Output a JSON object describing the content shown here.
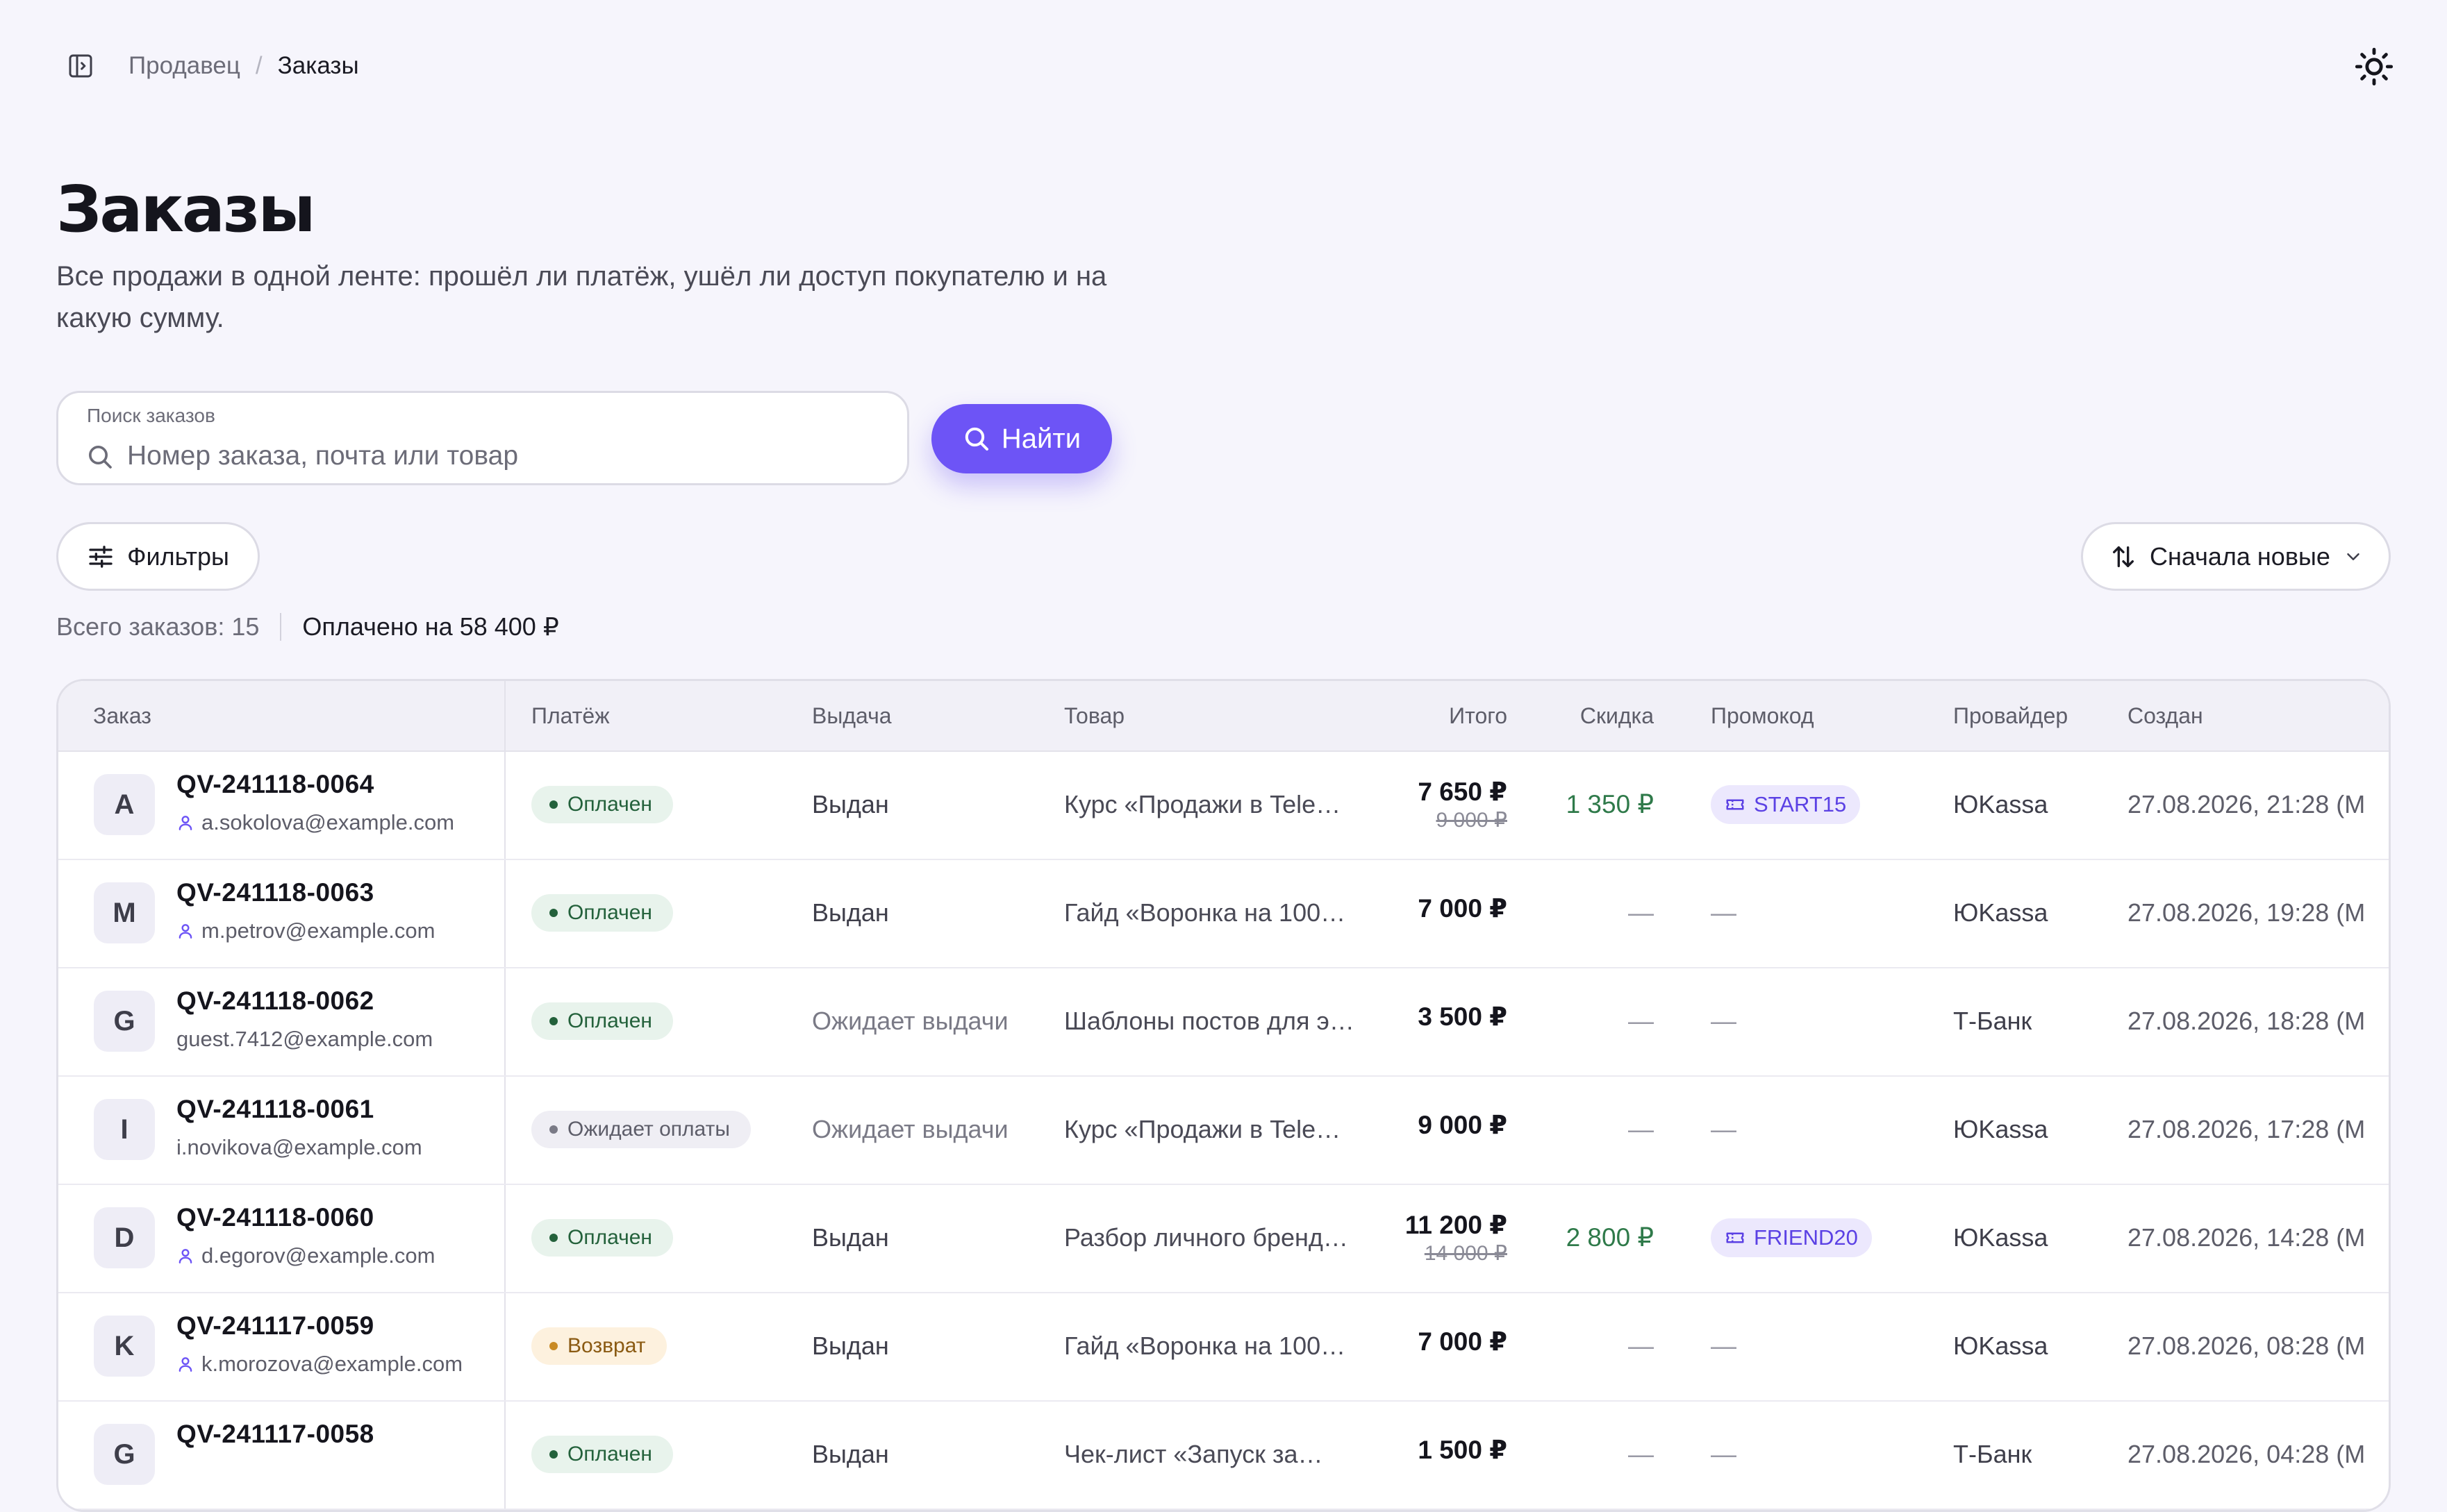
{
  "breadcrumb": {
    "parent": "Продавец",
    "separator": "/",
    "current": "Заказы"
  },
  "header": {
    "title": "Заказы",
    "subtitle": "Все продажи в одной ленте: прошёл ли платёж, ушёл ли доступ покупателю и на какую сумму."
  },
  "search": {
    "label": "Поиск заказов",
    "placeholder": "Номер заказа, почта или товар",
    "value": "",
    "button_label": "Найти"
  },
  "toolbar": {
    "filters_label": "Фильтры",
    "sort_label": "Сначала новые"
  },
  "summary": {
    "total_label": "Всего заказов: 15",
    "paid_label": "Оплачено на 58 400 ₽"
  },
  "colors": {
    "accent": "#6d54f6",
    "page_bg": "#f6f5fc",
    "paid_badge_bg": "#e8f3ec",
    "paid_badge_text": "#23613b",
    "pending_badge_bg": "#efeef4",
    "refund_badge_bg": "#fdf1de",
    "refund_badge_text": "#8a5a12",
    "discount_text": "#2f7a4a"
  },
  "table": {
    "columns": {
      "order": "Заказ",
      "payment": "Платёж",
      "delivery": "Выдача",
      "product": "Товар",
      "total": "Итого",
      "discount": "Скидка",
      "promo": "Промокод",
      "provider": "Провайдер",
      "created": "Создан"
    },
    "rows": [
      {
        "initial": "A",
        "id": "QV-241118-0064",
        "email": "a.sokolova@example.com",
        "user_icon": true,
        "status": "Оплачен",
        "status_kind": "paid",
        "delivery": "Выдан",
        "delivery_muted": false,
        "product": "Курс «Продажи в Tele…",
        "total": "7 650 ₽",
        "total_old": "9 000 ₽",
        "discount": "1 350 ₽",
        "promo": "START15",
        "provider": "ЮKassa",
        "created": "27.08.2026, 21:28 (М"
      },
      {
        "initial": "M",
        "id": "QV-241118-0063",
        "email": "m.petrov@example.com",
        "user_icon": true,
        "status": "Оплачен",
        "status_kind": "paid",
        "delivery": "Выдан",
        "delivery_muted": false,
        "product": "Гайд «Воронка на 100…",
        "total": "7 000 ₽",
        "total_old": "",
        "discount": "—",
        "promo": "",
        "provider": "ЮKassa",
        "created": "27.08.2026, 19:28 (М"
      },
      {
        "initial": "G",
        "id": "QV-241118-0062",
        "email": "guest.7412@example.com",
        "user_icon": false,
        "status": "Оплачен",
        "status_kind": "paid",
        "delivery": "Ожидает выдачи",
        "delivery_muted": true,
        "product": "Шаблоны постов для э…",
        "total": "3 500 ₽",
        "total_old": "",
        "discount": "—",
        "promo": "",
        "provider": "Т-Банк",
        "created": "27.08.2026, 18:28 (М"
      },
      {
        "initial": "I",
        "id": "QV-241118-0061",
        "email": "i.novikova@example.com",
        "user_icon": false,
        "status": "Ожидает оплаты",
        "status_kind": "pending",
        "delivery": "Ожидает выдачи",
        "delivery_muted": true,
        "product": "Курс «Продажи в Tele…",
        "total": "9 000 ₽",
        "total_old": "",
        "discount": "—",
        "promo": "",
        "provider": "ЮKassa",
        "created": "27.08.2026, 17:28 (М"
      },
      {
        "initial": "D",
        "id": "QV-241118-0060",
        "email": "d.egorov@example.com",
        "user_icon": true,
        "status": "Оплачен",
        "status_kind": "paid",
        "delivery": "Выдан",
        "delivery_muted": false,
        "product": "Разбор личного бренд…",
        "total": "11 200 ₽",
        "total_old": "14 000 ₽",
        "discount": "2 800 ₽",
        "promo": "FRIEND20",
        "provider": "ЮKassa",
        "created": "27.08.2026, 14:28 (М"
      },
      {
        "initial": "K",
        "id": "QV-241117-0059",
        "email": "k.morozova@example.com",
        "user_icon": true,
        "status": "Возврат",
        "status_kind": "refund",
        "delivery": "Выдан",
        "delivery_muted": false,
        "product": "Гайд «Воронка на 100…",
        "total": "7 000 ₽",
        "total_old": "",
        "discount": "—",
        "promo": "",
        "provider": "ЮKassa",
        "created": "27.08.2026, 08:28 (М"
      },
      {
        "initial": "G",
        "id": "QV-241117-0058",
        "email": "",
        "user_icon": false,
        "status": "Оплачен",
        "status_kind": "paid",
        "delivery": "Выдан",
        "delivery_muted": false,
        "product": "Чек-лист «Запуск за…",
        "total": "1 500 ₽",
        "total_old": "",
        "discount": "—",
        "promo": "",
        "provider": "Т-Банк",
        "created": "27.08.2026, 04:28 (М"
      }
    ]
  }
}
